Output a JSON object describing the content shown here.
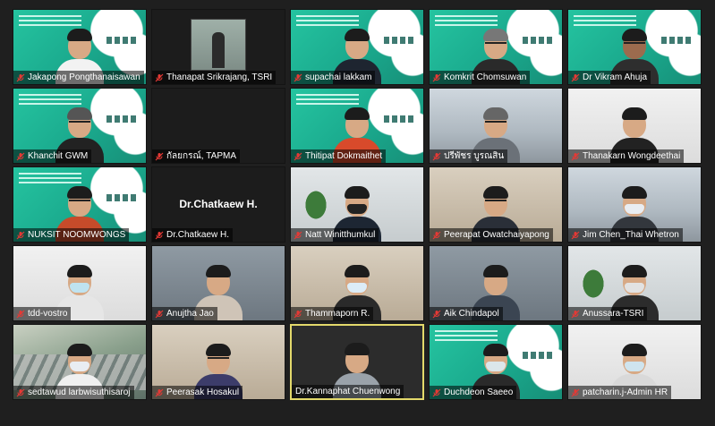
{
  "participants": [
    {
      "name": "Jakapong Pongthanaisawan"
    },
    {
      "name": "Thanapat Srikrajang, TSRI"
    },
    {
      "name": "supachai lakkam"
    },
    {
      "name": "Komkrit Chomsuwan"
    },
    {
      "name": "Dr Vikram Ahuja"
    },
    {
      "name": "Khanchit GWM"
    },
    {
      "name": "กัลยกรณ์, TAPMA"
    },
    {
      "name": "Thitipat Dokmaithet"
    },
    {
      "name": "ปรีพัชร บูรณสิน"
    },
    {
      "name": "Thanakarn Wongdeethai"
    },
    {
      "name": "NUKSIT NOOMWONGS"
    },
    {
      "name": "Dr.Chatkaew H.",
      "center_name": "Dr.Chatkaew H."
    },
    {
      "name": "Natt Winitthumkul"
    },
    {
      "name": "Peerapat Owatchaiyapong"
    },
    {
      "name": "Jim Chen_Thai Whetron"
    },
    {
      "name": "tdd-vostro"
    },
    {
      "name": "Anujtha Jao"
    },
    {
      "name": "Thammaporn R."
    },
    {
      "name": "Aik Chindapol"
    },
    {
      "name": "Anussara-TSRI"
    },
    {
      "name": "sedtawud larbwisuthisaroj"
    },
    {
      "name": "Peerasak Hosakul"
    },
    {
      "name": "Dr.Kannaphat Chuenwong"
    },
    {
      "name": "Duchdeon Saeeo"
    },
    {
      "name": "patcharin.j-Admin HR"
    }
  ],
  "colors": {
    "muted_mic": "#e53935",
    "active_speaker_border": "#e3d96b",
    "slide_green": "#1fb997"
  },
  "icons": {
    "muted_mic": "microphone-muted-icon"
  }
}
